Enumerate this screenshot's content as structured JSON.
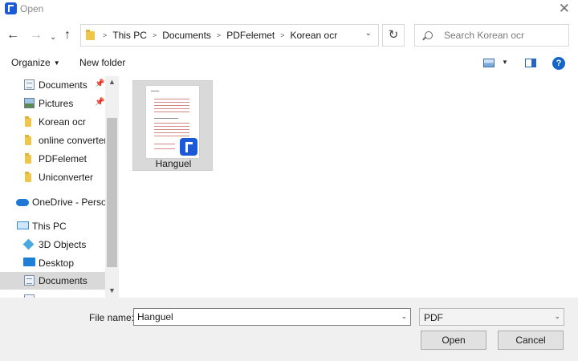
{
  "window": {
    "title": "Open"
  },
  "nav": {
    "breadcrumbs": [
      "This PC",
      "Documents",
      "PDFelemet",
      "Korean ocr"
    ],
    "search_placeholder": "Search Korean ocr"
  },
  "toolbar": {
    "organize_label": "Organize",
    "new_folder_label": "New folder"
  },
  "sidebar": {
    "items": [
      {
        "label": "Documents",
        "icon": "documents-icon",
        "pinned": true
      },
      {
        "label": "Pictures",
        "icon": "pictures-icon",
        "pinned": true
      },
      {
        "label": "Korean ocr",
        "icon": "folder-icon"
      },
      {
        "label": "online converter",
        "icon": "folder-icon"
      },
      {
        "label": "PDFelemet",
        "icon": "folder-icon"
      },
      {
        "label": "Uniconverter",
        "icon": "folder-icon"
      },
      {
        "label": "OneDrive - Person",
        "icon": "onedrive-cloud-icon"
      },
      {
        "label": "This PC",
        "icon": "computer-icon"
      },
      {
        "label": "3D Objects",
        "icon": "3d-objects-icon"
      },
      {
        "label": "Desktop",
        "icon": "desktop-icon"
      },
      {
        "label": "Documents",
        "icon": "documents-icon",
        "selected": true
      }
    ]
  },
  "files": [
    {
      "name": "Hanguel",
      "type": "pdf"
    }
  ],
  "footer": {
    "file_name_label": "File name:",
    "file_name_value": "Hanguel",
    "file_type_value": "PDF",
    "open_label": "Open",
    "cancel_label": "Cancel"
  },
  "colors": {
    "accent": "#1466c8",
    "selection": "#d9d9d9",
    "footer_bg": "#f0f0f0"
  }
}
